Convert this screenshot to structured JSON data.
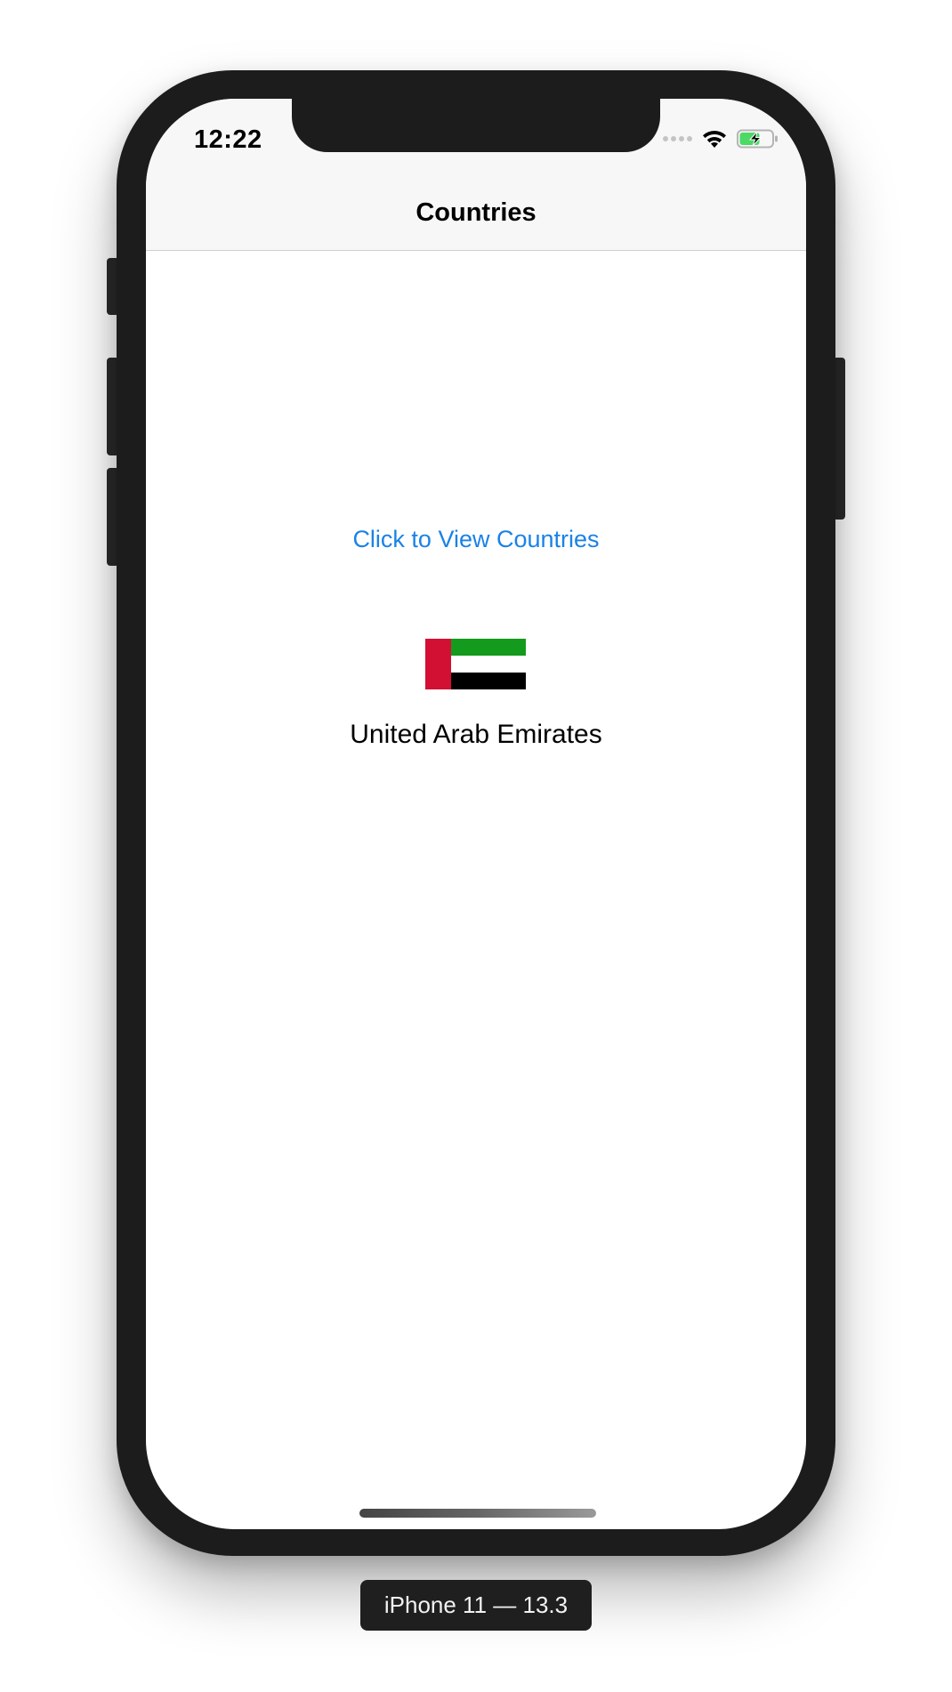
{
  "status_bar": {
    "time": "12:22",
    "icons": [
      "signal-dots-icon",
      "wifi-icon",
      "battery-charging-icon"
    ],
    "battery_color": "#4cd964"
  },
  "nav": {
    "title": "Countries"
  },
  "main": {
    "view_button_label": "Click to View Countries",
    "selected_country": {
      "name": "United Arab Emirates",
      "flag_icon": "uae-flag-icon",
      "flag_colors": {
        "red": "#d21034",
        "green": "#149a1c",
        "white": "#ffffff",
        "black": "#000000"
      }
    }
  },
  "accent_color": "#1a82e6",
  "simulator": {
    "device_label": "iPhone 11 — 13.3"
  }
}
